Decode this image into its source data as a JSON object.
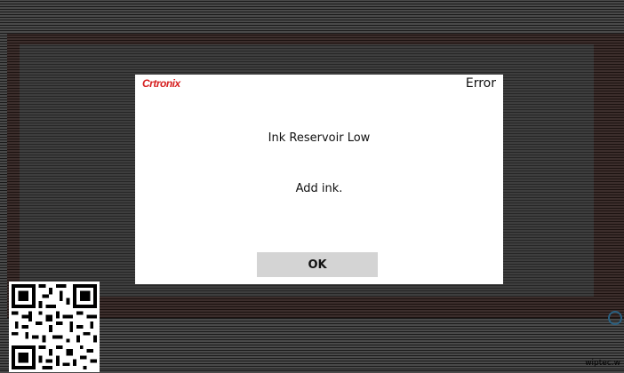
{
  "dialog": {
    "brand": "Crtronix",
    "title": "Error",
    "message": "Ink Reservoir Low",
    "instruction": "Add ink.",
    "ok_label": "OK"
  },
  "footer": {
    "corner_text": "wiptec.w"
  },
  "colors": {
    "brand_red": "#d62020",
    "button_gray": "#d4d4d4",
    "dialog_bg": "#ffffff"
  },
  "icons": [
    "status-ring-icon",
    "qr-code-icon"
  ]
}
